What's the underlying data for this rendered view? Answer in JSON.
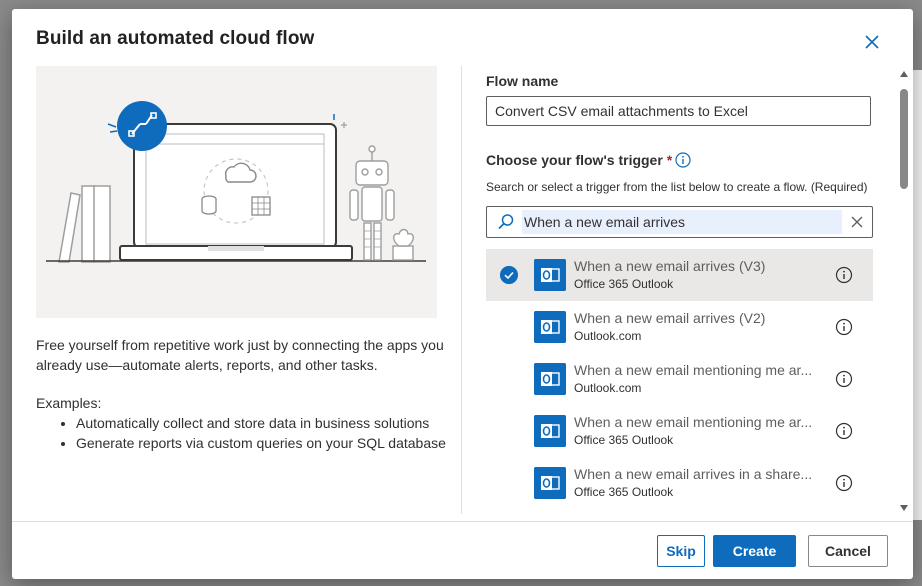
{
  "dialog": {
    "title": "Build an automated cloud flow",
    "description": "Free yourself from repetitive work just by connecting the apps you already use—automate alerts, reports, and other tasks.",
    "examples_label": "Examples:",
    "examples": [
      "Automatically collect and store data in business solutions",
      "Generate reports via custom queries on your SQL database"
    ]
  },
  "form": {
    "flow_name_label": "Flow name",
    "flow_name_value": "Convert CSV email attachments to Excel",
    "trigger_label": "Choose your flow's trigger",
    "required_mark": "*",
    "trigger_hint": "Search or select a trigger from the list below to create a flow. (Required)",
    "search_value": "When a new email arrives"
  },
  "triggers": [
    {
      "name": "When a new email arrives (V3)",
      "connector": "Office 365 Outlook",
      "selected": true
    },
    {
      "name": "When a new email arrives (V2)",
      "connector": "Outlook.com",
      "selected": false
    },
    {
      "name": "When a new email mentioning me ar...",
      "connector": "Outlook.com",
      "selected": false
    },
    {
      "name": "When a new email mentioning me ar...",
      "connector": "Office 365 Outlook",
      "selected": false
    },
    {
      "name": "When a new email arrives in a share...",
      "connector": "Office 365 Outlook",
      "selected": false
    }
  ],
  "footer": {
    "skip_label": "Skip",
    "create_label": "Create",
    "cancel_label": "Cancel"
  },
  "colors": {
    "accent": "#0f6cbd",
    "required": "#a4262c",
    "selected_row": "#e9e8e7"
  }
}
